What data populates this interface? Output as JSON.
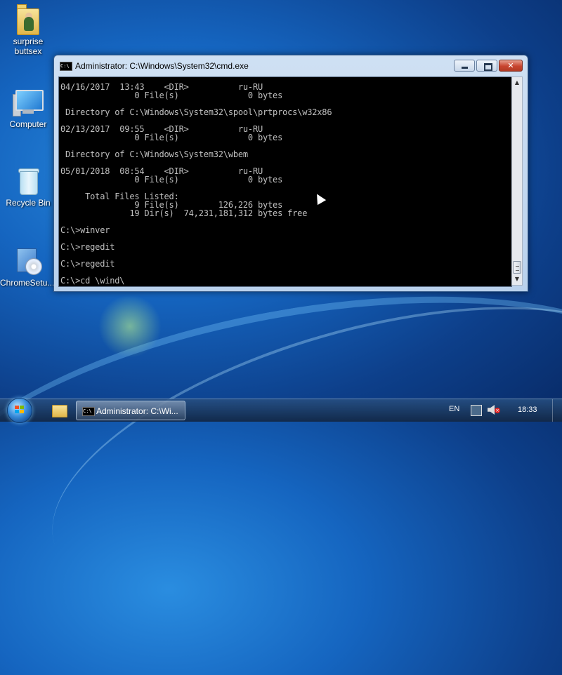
{
  "desktop": {
    "icons": [
      {
        "label": "surprise\nbuttsex",
        "line1": "surprise",
        "line2": "buttsex",
        "icon": "user-folder-icon"
      },
      {
        "label": "Computer",
        "icon": "computer-icon"
      },
      {
        "label": "Recycle Bin",
        "icon": "recycle-bin-icon"
      },
      {
        "label": "ChromeSetu...",
        "icon": "setup-disc-icon"
      }
    ]
  },
  "window": {
    "title": "Administrator: C:\\Windows\\System32\\cmd.exe",
    "icon_text": "C:\\",
    "controls": {
      "minimize": "minimize-button",
      "maximize": "maximize-button",
      "close": "close-button"
    },
    "console_lines": [
      "04/16/2017  13:43    <DIR>          ru-RU",
      "               0 File(s)              0 bytes",
      "",
      " Directory of C:\\Windows\\System32\\spool\\prtprocs\\w32x86",
      "",
      "02/13/2017  09:55    <DIR>          ru-RU",
      "               0 File(s)              0 bytes",
      "",
      " Directory of C:\\Windows\\System32\\wbem",
      "",
      "05/01/2018  08:54    <DIR>          ru-RU",
      "               0 File(s)              0 bytes",
      "",
      "     Total Files Listed:",
      "               9 File(s)        126,226 bytes",
      "              19 Dir(s)  74,231,181,312 bytes free",
      "",
      "C:\\>winver",
      "",
      "C:\\>regedit",
      "",
      "C:\\>regedit",
      "",
      "C:\\>cd \\wind\\"
    ]
  },
  "taskbar": {
    "start": "Start",
    "pinned_app_label": "Administrator: C:\\Wi...",
    "tray": {
      "language": "EN",
      "clock": "18:33"
    }
  },
  "colors": {
    "console_bg": "#000000",
    "console_text": "#c0c0c0",
    "close_red": "#c8452f"
  }
}
